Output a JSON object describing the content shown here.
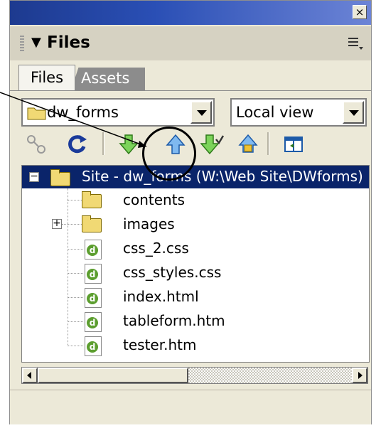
{
  "window": {
    "close_glyph": "×"
  },
  "panel": {
    "title": "Files",
    "collapse_glyph": "▼",
    "options_icon": "options-menu-icon"
  },
  "tabs": [
    {
      "label": "Files"
    },
    {
      "label": "Assets"
    }
  ],
  "site_select": {
    "value": "dw_forms"
  },
  "view_select": {
    "value": "Local view"
  },
  "toolbar": {
    "buttons": [
      {
        "name": "connect-icon"
      },
      {
        "name": "refresh-icon"
      },
      {
        "name": "get-files-icon"
      },
      {
        "name": "put-files-icon"
      },
      {
        "name": "check-out-icon"
      },
      {
        "name": "check-in-icon"
      },
      {
        "name": "expand-show-site-icon"
      }
    ]
  },
  "tree": {
    "root": {
      "label": "Site - dw_forms (W:\\Web Site\\DWforms)",
      "expanded_glyph": "−"
    },
    "items": [
      {
        "label": "contents",
        "type": "folder"
      },
      {
        "label": "images",
        "type": "folder",
        "expand_glyph": "+"
      },
      {
        "label": "css_2.css",
        "type": "file"
      },
      {
        "label": "css_styles.css",
        "type": "file"
      },
      {
        "label": "index.html",
        "type": "file"
      },
      {
        "label": "tableform.htm",
        "type": "file"
      },
      {
        "label": "tester.htm",
        "type": "file"
      }
    ]
  },
  "colors": {
    "selection": "#0a246a",
    "titlebar": "#2a4fb5",
    "panel_bg": "#ece9d8"
  }
}
